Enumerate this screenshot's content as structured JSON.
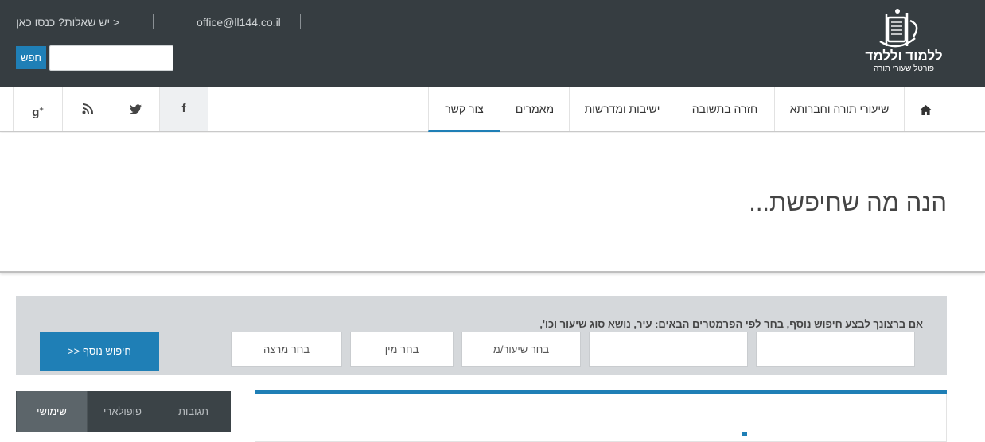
{
  "header": {
    "questions_link": "יש שאלות? כנסו כאן >",
    "email": "office@ll144.co.il",
    "search_button": "חפש",
    "search_placeholder": "",
    "logo_title": "ללמוד וללמד",
    "logo_subtitle": "פורטל שעורי תורה",
    "bg_color": "#363d41",
    "accent_color": "#1f7fb6"
  },
  "nav": {
    "home_icon": "home-icon",
    "items": [
      {
        "label": "שיעורי תורה וחברותא"
      },
      {
        "label": "חזרה בתשובה"
      },
      {
        "label": "ישיבות ומדרשות"
      },
      {
        "label": "מאמרים"
      },
      {
        "label": "צור קשר"
      }
    ],
    "social": [
      {
        "icon": "facebook-icon",
        "glyph": "f"
      },
      {
        "icon": "twitter-icon",
        "glyph": "🐦"
      },
      {
        "icon": "rss-icon",
        "glyph": ""
      },
      {
        "icon": "google-plus-icon",
        "glyph": "g+"
      }
    ]
  },
  "hero": {
    "title": "הנה מה שחיפשת..."
  },
  "advanced_search": {
    "description": "אם ברצונך לבצע חיפוש נוסף, בחר לפי הפרמטרים הבאים: עיר, נושא סוג שיעור וכו',",
    "selects": [
      {
        "label": ""
      },
      {
        "label": ""
      },
      {
        "label": "בחר שיעור/מ"
      },
      {
        "label": "בחר מין"
      },
      {
        "label": "בחר מרצה"
      }
    ],
    "button_label": ">> חיפוש נוסף"
  },
  "sidebar_tabs": [
    {
      "label": "שימושי"
    },
    {
      "label": "פופולארי"
    },
    {
      "label": "תגובות"
    }
  ]
}
